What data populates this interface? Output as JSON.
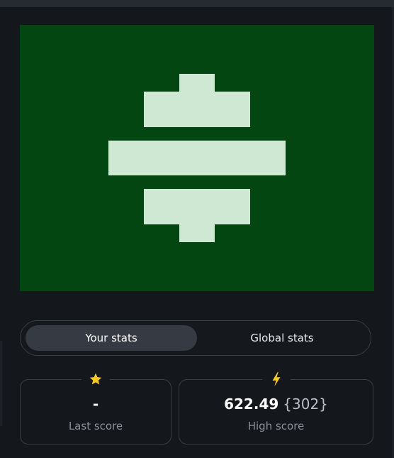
{
  "stats_toggle": {
    "your_stats_label": "Your stats",
    "global_stats_label": "Global stats",
    "selected": "Your stats"
  },
  "last_score": {
    "value": "-",
    "label": "Last score",
    "icon": "star-icon"
  },
  "high_score": {
    "value": "622.49",
    "count": "{302}",
    "label": "High score",
    "icon": "lightning-bolt-icon"
  },
  "colors": {
    "background": "#14171c",
    "canvas": "#034612",
    "glyph": "#cfe8d3",
    "accent_yellow": "#f7c923",
    "active_tab": "#353a43"
  }
}
